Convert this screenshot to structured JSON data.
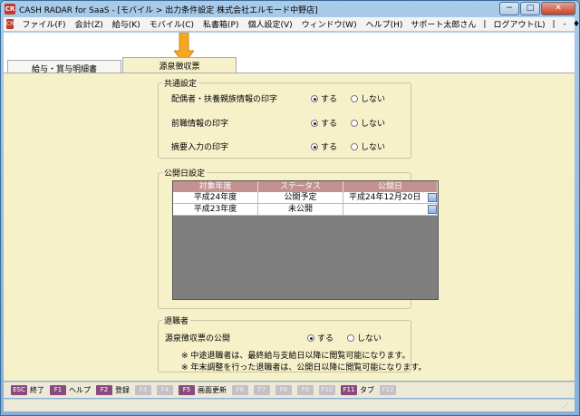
{
  "window": {
    "app_icon": "CR",
    "title": "CASH RADAR for SaaS - [モバイル > 出力条件設定 株式会社エルモード中野店]",
    "minimize": "−",
    "maximize": "□",
    "close": "✕"
  },
  "menubar": {
    "icon": "CR",
    "items": [
      "ファイル(F)",
      "会計(Z)",
      "給与(K)",
      "モバイル(C)",
      "私書箱(P)",
      "個人設定(V)",
      "ウィンドウ(W)",
      "ヘルプ(H)"
    ],
    "user": "サポート太郎さん",
    "logout": "ログアウト(L)",
    "mdi_min": "-",
    "mdi_restore": "♦",
    "mdi_close": "×"
  },
  "tabs": [
    {
      "label": "給与・賞与明細書",
      "active": false
    },
    {
      "label": "源泉徴収票",
      "active": true
    }
  ],
  "common": {
    "legend": "共通設定",
    "rows": [
      {
        "label": "配偶者・扶養親族情報の印字",
        "on": "する",
        "off": "しない",
        "selected": "on"
      },
      {
        "label": "前職情報の印字",
        "on": "する",
        "off": "しない",
        "selected": "on"
      },
      {
        "label": "摘要入力の印字",
        "on": "する",
        "off": "しない",
        "selected": "on"
      }
    ]
  },
  "publish": {
    "legend": "公開日設定",
    "headers": [
      "対象年度",
      "ステータス",
      "公開日"
    ],
    "rows": [
      {
        "year": "平成24年度",
        "status": "公開予定",
        "date": "平成24年12月20日"
      },
      {
        "year": "平成23年度",
        "status": "未公開",
        "date": ""
      }
    ]
  },
  "retiree": {
    "legend": "退職者",
    "label": "源泉徴収票の公開",
    "on": "する",
    "off": "しない",
    "selected": "on",
    "notes": [
      "※ 中途退職者は、最終給与支給日以降に閲覧可能になります。",
      "※ 年末調整を行った退職者は、公開日以降に閲覧可能になります。"
    ]
  },
  "fkeys": [
    {
      "key": "ESC",
      "label": "終了",
      "enabled": true
    },
    {
      "key": "F1",
      "label": "ヘルプ",
      "enabled": true
    },
    {
      "key": "F2",
      "label": "登録",
      "enabled": true
    },
    {
      "key": "F3",
      "label": "",
      "enabled": false
    },
    {
      "key": "F4",
      "label": "",
      "enabled": false
    },
    {
      "key": "F5",
      "label": "画面更新",
      "enabled": true
    },
    {
      "key": "F6",
      "label": "",
      "enabled": false
    },
    {
      "key": "F7",
      "label": "",
      "enabled": false
    },
    {
      "key": "F8",
      "label": "",
      "enabled": false
    },
    {
      "key": "F9",
      "label": "",
      "enabled": false
    },
    {
      "key": "F10",
      "label": "",
      "enabled": false
    },
    {
      "key": "F11",
      "label": "タブ",
      "enabled": true
    },
    {
      "key": "F12",
      "label": "",
      "enabled": false
    }
  ],
  "colors": {
    "panel_bg": "#f6f1c9",
    "grid_header": "#c49191",
    "fkey": "#8a4a7e",
    "arrow": "#f5a623"
  }
}
